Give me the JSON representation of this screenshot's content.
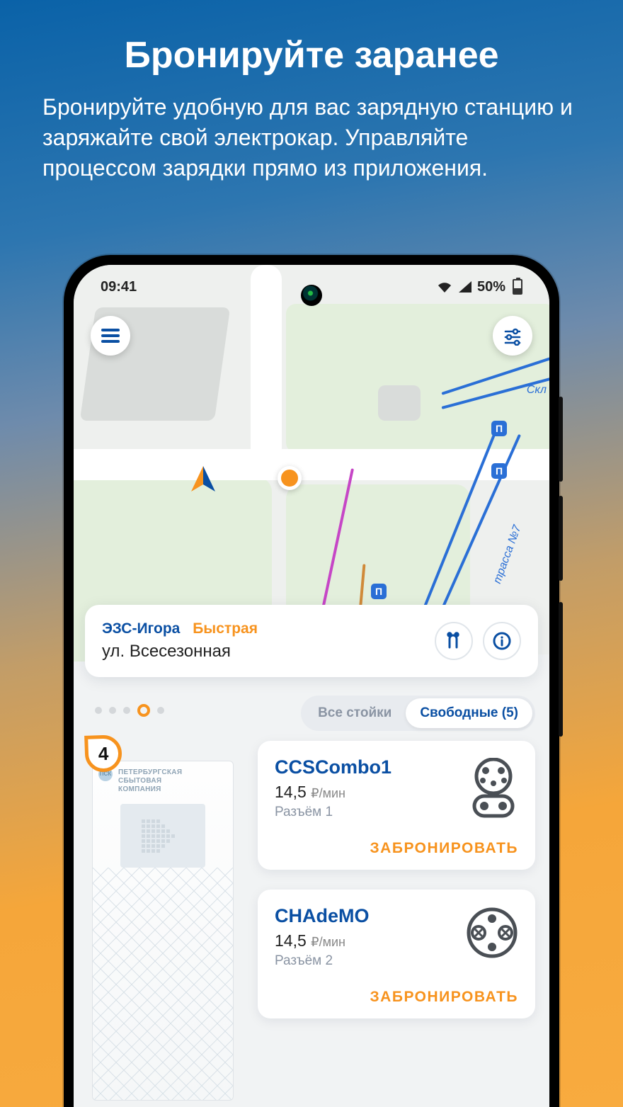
{
  "promo": {
    "headline": "Бронируйте заранее",
    "subtext": "Бронируйте удобную для вас зарядную станцию и заряжайте свой электрокар. Управляйте процессом зарядки прямо из приложения."
  },
  "status_bar": {
    "time": "09:41",
    "battery_pct": "50%"
  },
  "map": {
    "street_label_1": "Скл",
    "ski_trail_label": "трасса №7",
    "bus_glyph": "П"
  },
  "station": {
    "name": "ЭЗС-Игора",
    "speed": "Быстрая",
    "address": "ул. Всесезонная"
  },
  "filter": {
    "all_label": "Все стойки",
    "free_label": "Свободные (5)"
  },
  "stand": {
    "badge": "4",
    "brand_line1": "ПЕТЕРБУРГСКАЯ",
    "brand_line2": "СБЫТОВАЯ",
    "brand_line3": "КОМПАНИЯ",
    "logo_text": "ПСК"
  },
  "connectors": [
    {
      "title": "CCSCombo1",
      "price_value": "14,5",
      "price_unit": "₽/мин",
      "slot": "Разъём 1",
      "action": "ЗАБРОНИРОВАТЬ",
      "plug_type": "ccs"
    },
    {
      "title": "CHAdeMO",
      "price_value": "14,5",
      "price_unit": "₽/мин",
      "slot": "Разъём 2",
      "action": "ЗАБРОНИРОВАТЬ",
      "plug_type": "chademo"
    }
  ]
}
